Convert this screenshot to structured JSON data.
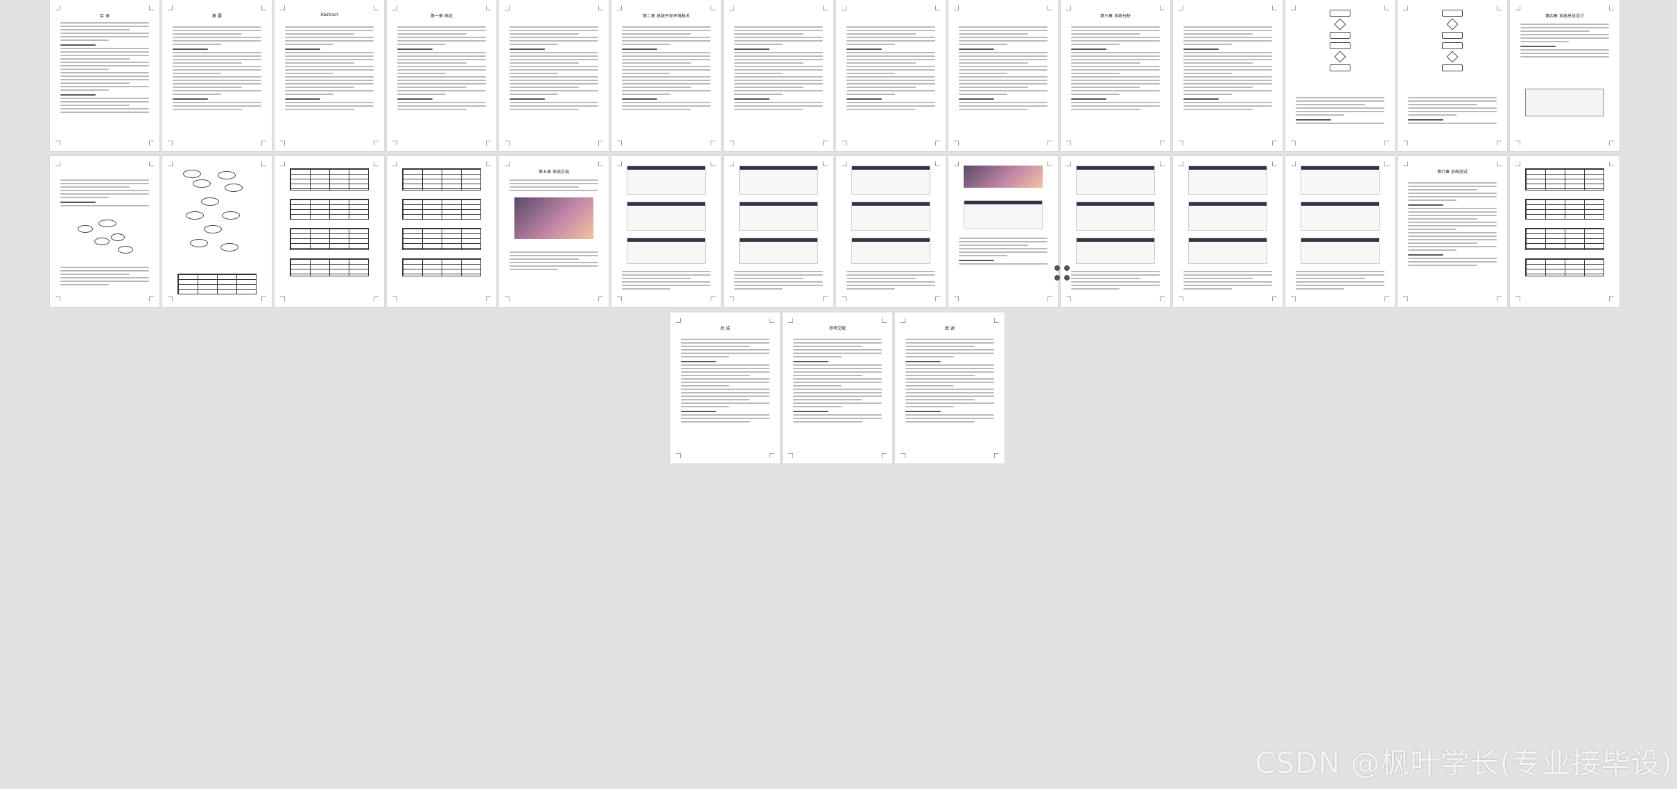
{
  "viewer": {
    "watermark": "CSDN @枫叶学长(专业接毕设)"
  },
  "rows": [
    {
      "pages": [
        {
          "title": "目 录",
          "kind": "toc"
        },
        {
          "title": "摘 要",
          "kind": "text"
        },
        {
          "title": "Abstract",
          "kind": "text"
        },
        {
          "title": "第一章 绪论",
          "kind": "text"
        },
        {
          "title": "",
          "kind": "text"
        },
        {
          "title": "第二章 系统开发环境技术",
          "kind": "text"
        },
        {
          "title": "",
          "kind": "text"
        },
        {
          "title": "",
          "kind": "text"
        },
        {
          "title": "",
          "kind": "text"
        },
        {
          "title": "第三章 系统分析",
          "kind": "text"
        },
        {
          "title": "",
          "kind": "text"
        },
        {
          "title": "",
          "kind": "flowchart"
        },
        {
          "title": "",
          "kind": "flowchart"
        },
        {
          "title": "第四章 系统总体设计",
          "kind": "tree"
        }
      ]
    },
    {
      "pages": [
        {
          "title": "",
          "kind": "er"
        },
        {
          "title": "",
          "kind": "er2"
        },
        {
          "title": "",
          "kind": "tables"
        },
        {
          "title": "",
          "kind": "tables"
        },
        {
          "title": "第五章 系统实现",
          "kind": "photo"
        },
        {
          "title": "",
          "kind": "screens"
        },
        {
          "title": "",
          "kind": "screens"
        },
        {
          "title": "",
          "kind": "screens"
        },
        {
          "title": "",
          "kind": "photos"
        },
        {
          "title": "",
          "kind": "screens"
        },
        {
          "title": "",
          "kind": "screens"
        },
        {
          "title": "",
          "kind": "screens"
        },
        {
          "title": "第六章 系统测试",
          "kind": "text"
        },
        {
          "title": "",
          "kind": "tables"
        }
      ]
    },
    {
      "pages": [
        {
          "title": "总 结",
          "kind": "text"
        },
        {
          "title": "参考文献",
          "kind": "text"
        },
        {
          "title": "致 谢",
          "kind": "text"
        }
      ]
    }
  ]
}
